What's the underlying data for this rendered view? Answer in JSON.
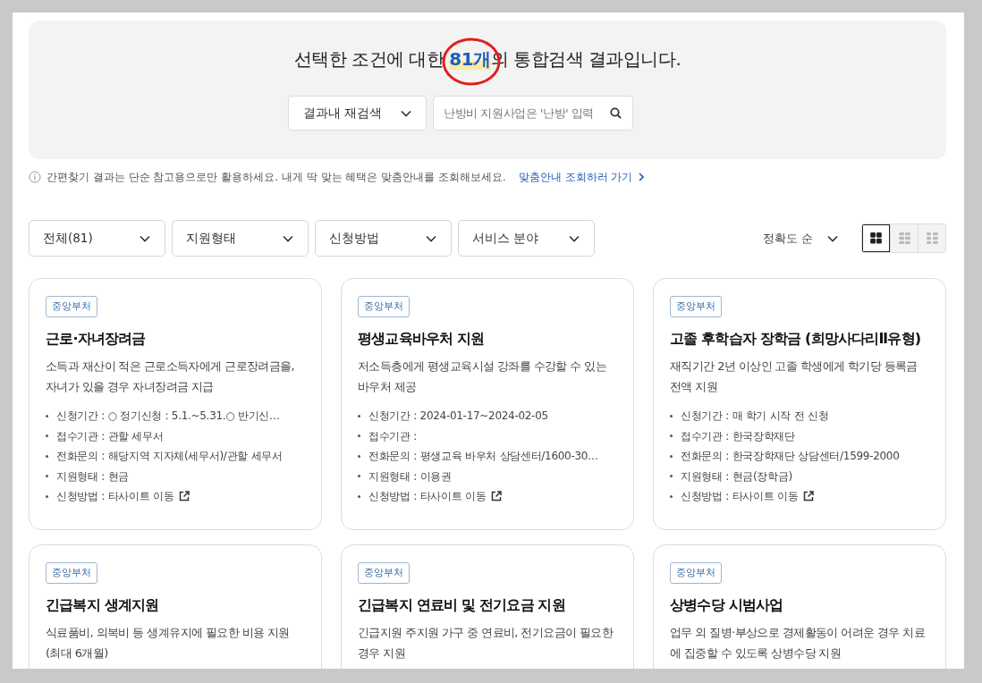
{
  "search_panel": {
    "heading_before": "선택한 조건에 대한 ",
    "count": "81개",
    "heading_after": "의 통합검색 결과입니다.",
    "count_circled": true,
    "scope_select": "결과내 재검색",
    "query": {
      "placeholder": "난방비 지원사업은 '난방' 입력"
    }
  },
  "notice": {
    "text": "간편찾기 결과는 단순 참고용으로만 활용하세요. 내게 딱 맞는 혜택은 맞춤안내를 조회해보세요.",
    "link": "맞춤안내 조회하러 가기"
  },
  "filters": [
    "전체(81)",
    "지원형태",
    "신청방법",
    "서비스 분야"
  ],
  "sort": "정확도 순",
  "views": [
    {
      "kind": "grid",
      "selected": true
    },
    {
      "kind": "grid-small",
      "selected": false
    },
    {
      "kind": "list",
      "selected": false
    }
  ],
  "cards": [
    {
      "badge": "중앙부처",
      "title": "근로·자녀장려금",
      "description": "소득과 재산이 적은 근로소득자에게 근로장려금을, 자녀가 있을 경우 자녀장려금 지급",
      "items": [
        {
          "kind": "text",
          "text": "신청기간 : ○ 정기신청 : 5.1.~5.31.○ 반기신…"
        },
        {
          "kind": "text",
          "text": "접수기관 : 관할 세무서"
        },
        {
          "kind": "text",
          "text": "전화문의 : 해당지역 지자체(세무서)/관할 세무서"
        },
        {
          "kind": "text",
          "text": "지원형태 : 현금"
        },
        {
          "kind": "external",
          "text": "신청방법 : 타사이트 이동"
        }
      ]
    },
    {
      "badge": "중앙부처",
      "title": "평생교육바우처 지원",
      "description": "저소득층에게 평생교육시설 강좌를 수강할 수 있는 바우처 제공",
      "items": [
        {
          "kind": "text",
          "text": "신청기간 : 2024-01-17~2024-02-05"
        },
        {
          "kind": "text",
          "text": "접수기관 :"
        },
        {
          "kind": "text",
          "text": "전화문의 : 평생교육 바우처 상담센터/1600-30…"
        },
        {
          "kind": "text",
          "text": "지원형태 : 이용권"
        },
        {
          "kind": "external",
          "text": "신청방법 : 타사이트 이동"
        }
      ]
    },
    {
      "badge": "중앙부처",
      "title": "고졸 후학습자 장학금 (희망사다리Ⅱ유형)",
      "description": "재직기간 2년 이상인 고졸 학생에게 학기당 등록금 전액 지원",
      "items": [
        {
          "kind": "text",
          "text": "신청기간 : 매 학기 시작 전 신청"
        },
        {
          "kind": "text",
          "text": "접수기관 : 한국장학재단"
        },
        {
          "kind": "text",
          "text": "전화문의 : 한국장학재단 상담센터/1599-2000"
        },
        {
          "kind": "text",
          "text": "지원형태 : 현금(장학금)"
        },
        {
          "kind": "external",
          "text": "신청방법 : 타사이트 이동"
        }
      ]
    },
    {
      "badge": "중앙부처",
      "title": "긴급복지 생계지원",
      "description": "식료품비, 의복비 등 생계유지에 필요한 비용 지원 (최대 6개월)"
    },
    {
      "badge": "중앙부처",
      "title": "긴급복지 연료비 및 전기요금 지원",
      "description": "긴급지원 주지원 가구 중 연료비, 전기요금이 필요한 경우 지원"
    },
    {
      "badge": "중앙부처",
      "title": "상병수당 시범사업",
      "description": "업무 외 질병·부상으로 경제활동이 어려운 경우 치료에 집중할 수 있도록 상병수당 지원"
    }
  ]
}
